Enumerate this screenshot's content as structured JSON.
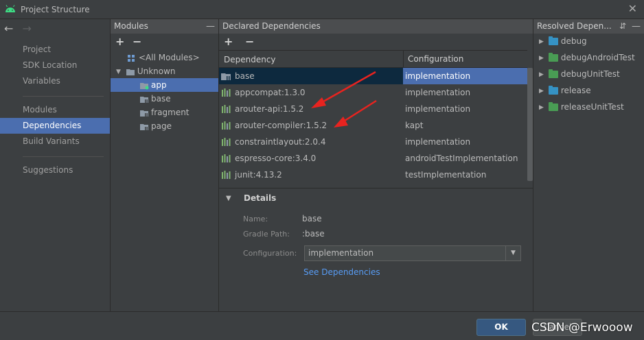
{
  "window": {
    "title": "Project Structure",
    "close": "✕"
  },
  "nav": {
    "back": "←",
    "forward": "→",
    "items": [
      {
        "label": "Project"
      },
      {
        "label": "SDK Location"
      },
      {
        "label": "Variables"
      },
      {
        "label": "Modules"
      },
      {
        "label": "Dependencies"
      },
      {
        "label": "Build Variants"
      },
      {
        "label": "Suggestions"
      }
    ]
  },
  "modules": {
    "header": "Modules",
    "collapse": "—",
    "add": "+",
    "remove": "−",
    "tree": [
      {
        "label": "<All Modules>"
      },
      {
        "label": "Unknown"
      },
      {
        "label": "app"
      },
      {
        "label": "base"
      },
      {
        "label": "fragment"
      },
      {
        "label": "page"
      }
    ]
  },
  "declared": {
    "header": "Declared Dependencies",
    "add": "+",
    "remove": "−",
    "columns": {
      "dependency": "Dependency",
      "configuration": "Configuration"
    },
    "rows": [
      {
        "name": "base",
        "configuration": "implementation"
      },
      {
        "name": "appcompat:1.3.0",
        "configuration": "implementation"
      },
      {
        "name": "arouter-api:1.5.2",
        "configuration": "implementation"
      },
      {
        "name": "arouter-compiler:1.5.2",
        "configuration": "kapt"
      },
      {
        "name": "constraintlayout:2.0.4",
        "configuration": "implementation"
      },
      {
        "name": "espresso-core:3.4.0",
        "configuration": "androidTestImplementation"
      },
      {
        "name": "junit:4.13.2",
        "configuration": "testImplementation"
      }
    ]
  },
  "details": {
    "title": "Details",
    "name_label": "Name:",
    "name_value": "base",
    "gradle_label": "Gradle Path:",
    "gradle_value": ":base",
    "config_label": "Configuration:",
    "config_value": "implementation",
    "link": "See Dependencies"
  },
  "resolved": {
    "header": "Resolved Depen...",
    "items": [
      {
        "label": "debug",
        "color": "#3592c4"
      },
      {
        "label": "debugAndroidTest",
        "color": "#499c54"
      },
      {
        "label": "debugUnitTest",
        "color": "#499c54"
      },
      {
        "label": "release",
        "color": "#3592c4"
      },
      {
        "label": "releaseUnitTest",
        "color": "#499c54"
      }
    ]
  },
  "buttons": {
    "ok": "OK",
    "cancel": "Cancel"
  },
  "watermark": "CSDN @Erwooow",
  "colors": {
    "selection": "#4b6eaf",
    "arrow": "#e8231f",
    "link": "#589df6"
  }
}
